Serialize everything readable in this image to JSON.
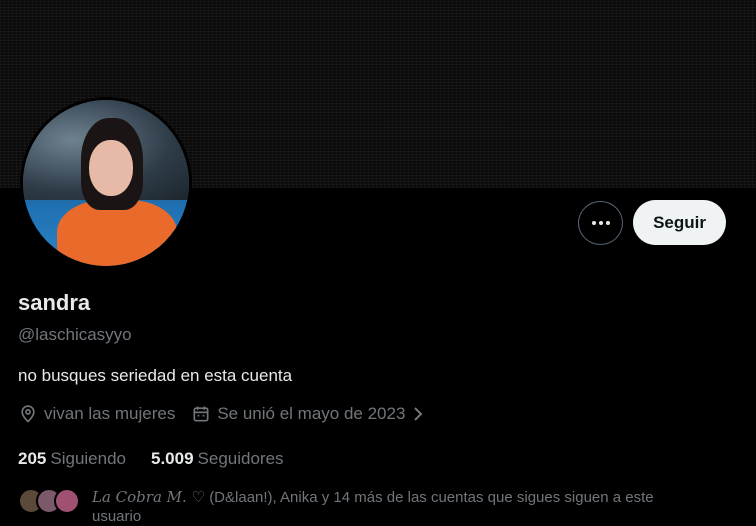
{
  "profile": {
    "name": "sandra",
    "handle": "@laschicasyyo",
    "bio": "no busques seriedad en esta cuenta",
    "location": "vivan las mujeres",
    "joined": "Se unió el mayo de 2023"
  },
  "actions": {
    "follow_label": "Seguir"
  },
  "stats": {
    "following_count": "205",
    "following_label": "Siguiendo",
    "followers_count": "5.009",
    "followers_label": "Seguidores"
  },
  "followers_you_know": {
    "name1": "La Cobra M. ♡",
    "name2": "(D&laan!)",
    "rest": ", Anika y 14 más de las cuentas que sigues siguen a este usuario"
  },
  "icons": {
    "more": "more-horizontal-icon",
    "location": "location-pin-icon",
    "calendar": "calendar-icon",
    "chevron": "chevron-right-icon"
  },
  "colors": {
    "background": "#000000",
    "text_primary": "#e7e9ea",
    "text_secondary": "#71767b",
    "follow_button_bg": "#eff3f4",
    "follow_button_text": "#0f1419",
    "border": "#536471"
  }
}
